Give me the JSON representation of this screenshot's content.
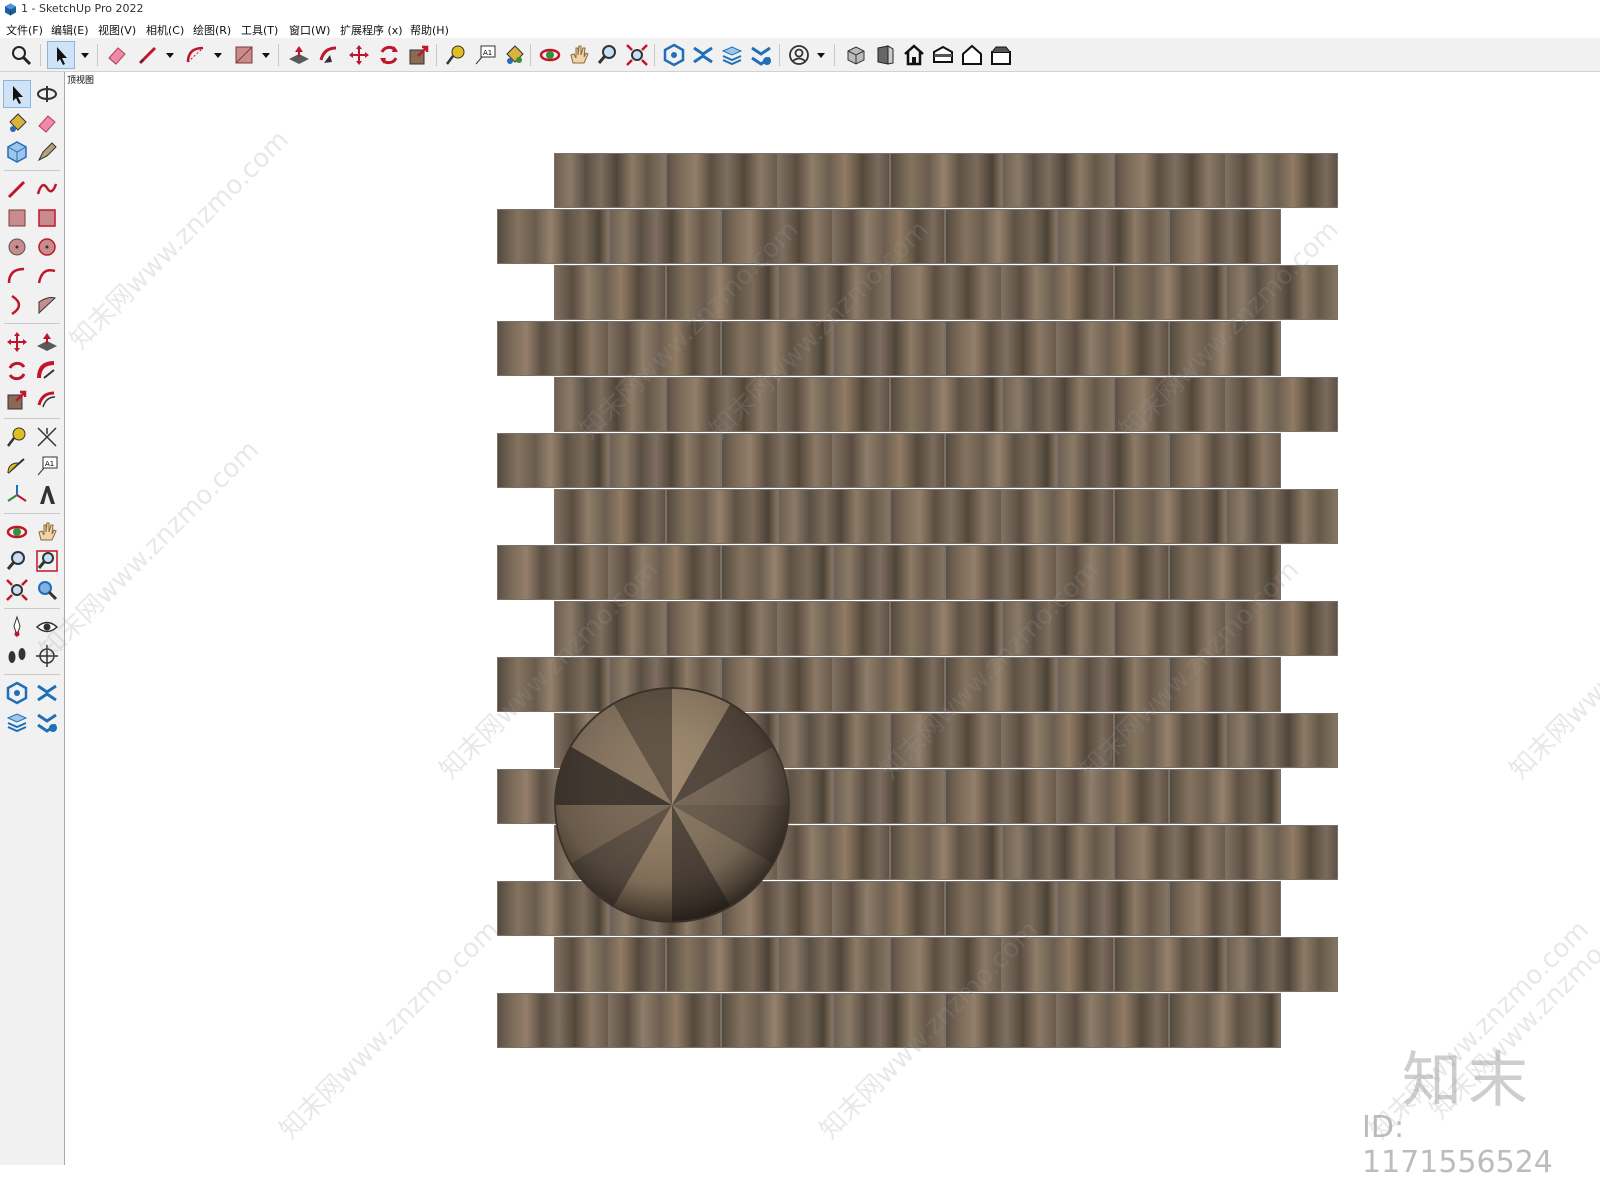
{
  "window": {
    "title": "1 - SketchUp Pro 2022"
  },
  "menu": [
    {
      "name": "menu-file",
      "label": "文件(F)"
    },
    {
      "name": "menu-edit",
      "label": "编辑(E)"
    },
    {
      "name": "menu-view",
      "label": "视图(V)"
    },
    {
      "name": "menu-camera",
      "label": "相机(C)"
    },
    {
      "name": "menu-draw",
      "label": "绘图(R)"
    },
    {
      "name": "menu-tools",
      "label": "工具(T)"
    },
    {
      "name": "menu-window",
      "label": "窗口(W)"
    },
    {
      "name": "menu-extensions",
      "label": "扩展程序 (x)"
    },
    {
      "name": "menu-help",
      "label": "帮助(H)"
    }
  ],
  "toolbar": {
    "tools": [
      "zoom-icon",
      "select-icon",
      "eraser-icon",
      "line-icon",
      "arc-icon",
      "rectangle-icon",
      "push-pull-icon",
      "follow-me-icon",
      "move-icon",
      "rotate-icon",
      "scale-icon",
      "tape-measure-icon",
      "text-icon",
      "paint-bucket-icon",
      "orbit-icon",
      "pan-icon",
      "zoom-window-icon",
      "zoom-extents-icon",
      "warehouse-icon",
      "extension-warehouse-icon",
      "layout-icon",
      "extension-manager-icon",
      "account-icon",
      "iso-view-icon",
      "front-view-icon",
      "top-view-icon",
      "right-view-icon",
      "back-view-icon",
      "left-view-icon"
    ]
  },
  "left_toolbar": {
    "tools": [
      "select-icon",
      "orbit-icon",
      "paint-bucket-icon",
      "eraser-icon",
      "component-icon",
      "pencil-tag-icon",
      "line-icon",
      "freehand-icon",
      "rectangle-icon",
      "rotated-rectangle-icon",
      "circle-icon",
      "polygon-icon",
      "arc-icon",
      "two-point-arc-icon",
      "three-point-arc-icon",
      "pie-icon",
      "move-icon",
      "push-pull-icon",
      "rotate-icon",
      "follow-me-icon",
      "scale-icon",
      "offset-icon",
      "tape-measure-icon",
      "dimension-icon",
      "protractor-icon",
      "text-icon",
      "axes-icon",
      "3d-text-icon",
      "orbit-icon",
      "pan-icon",
      "zoom-icon",
      "zoom-window-icon",
      "zoom-extents-icon",
      "previous-view-icon",
      "position-camera-icon",
      "look-around-icon",
      "walk-icon",
      "section-plane-icon",
      "warehouse-icon",
      "extension-warehouse-icon",
      "layout-icon",
      "extension-manager-icon"
    ]
  },
  "scene": {
    "tab_label": "顶视图",
    "tile_rows": 16,
    "tiles_per_row": 7
  },
  "overlay": {
    "watermark_text": "知末网www.znzmo.com",
    "brand_logo": "知末",
    "brand_id": "ID: 1171556524"
  },
  "colors": {
    "toolbar_bg": "#f1f1f1",
    "active_tool": "#cfe3f7",
    "tile_tone": "#6e6052",
    "sphere_tone": "#6b5d4f"
  }
}
